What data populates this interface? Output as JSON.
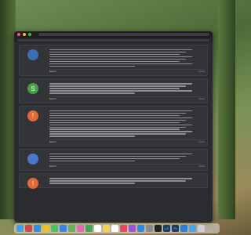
{
  "window": {
    "title": "",
    "url": ""
  },
  "posts": [
    {
      "avatar_color": "#3b6fb5",
      "meta": "",
      "lines": 8,
      "footer_left": "Report",
      "footer_right": "Quote"
    },
    {
      "avatar_color": "#43a047",
      "avatar_letter": "S",
      "meta": "",
      "lines": 5,
      "footer_left": "Report",
      "footer_right": "Quote"
    },
    {
      "avatar_color": "#e06a3a",
      "avatar_letter": "!",
      "meta": "",
      "lines": 12,
      "footer_left": "Report",
      "footer_right": "Quote"
    },
    {
      "avatar_color": "#4a78c8",
      "meta": "",
      "lines": 4,
      "footer_left": "Report",
      "footer_right": "Quote"
    },
    {
      "avatar_color": "#e06a3a",
      "avatar_letter": "!",
      "meta": "",
      "lines": 3,
      "footer_left": "",
      "footer_right": ""
    }
  ],
  "dock": {
    "apps": [
      {
        "name": "finder-icon",
        "color": "#3ea0f0"
      },
      {
        "name": "launchpad-icon",
        "color": "#c94b4b"
      },
      {
        "name": "safari-icon",
        "color": "#2e8fe6"
      },
      {
        "name": "chrome-icon",
        "color": "#e8c02e"
      },
      {
        "name": "messages-icon",
        "color": "#46c35a"
      },
      {
        "name": "mail-icon",
        "color": "#3c82e6"
      },
      {
        "name": "maps-icon",
        "color": "#62b05a"
      },
      {
        "name": "photos-icon",
        "color": "#e06bb0"
      },
      {
        "name": "facetime-icon",
        "color": "#3aaa55"
      },
      {
        "name": "calendar-icon",
        "color": "#ffffff"
      },
      {
        "name": "notes-icon",
        "color": "#f1d44b"
      },
      {
        "name": "reminders-icon",
        "color": "#ffffff"
      },
      {
        "name": "music-icon",
        "color": "#f0455a"
      },
      {
        "name": "podcasts-icon",
        "color": "#9c52d8"
      },
      {
        "name": "appstore-icon",
        "color": "#2d8ae6"
      },
      {
        "name": "settings-icon",
        "color": "#8a8a8a"
      },
      {
        "name": "terminal-icon",
        "color": "#222222"
      },
      {
        "name": "lr-icon",
        "color": "#1d3b5a"
      },
      {
        "name": "ps-icon",
        "color": "#1f3a5f"
      },
      {
        "name": "vscode-icon",
        "color": "#2a7ed6"
      },
      {
        "name": "folder-icon",
        "color": "#4ea3e8"
      },
      {
        "name": "trash-icon",
        "color": "#cfcfcf"
      }
    ],
    "label_lr": "LrC",
    "label_ps": "Ps"
  }
}
